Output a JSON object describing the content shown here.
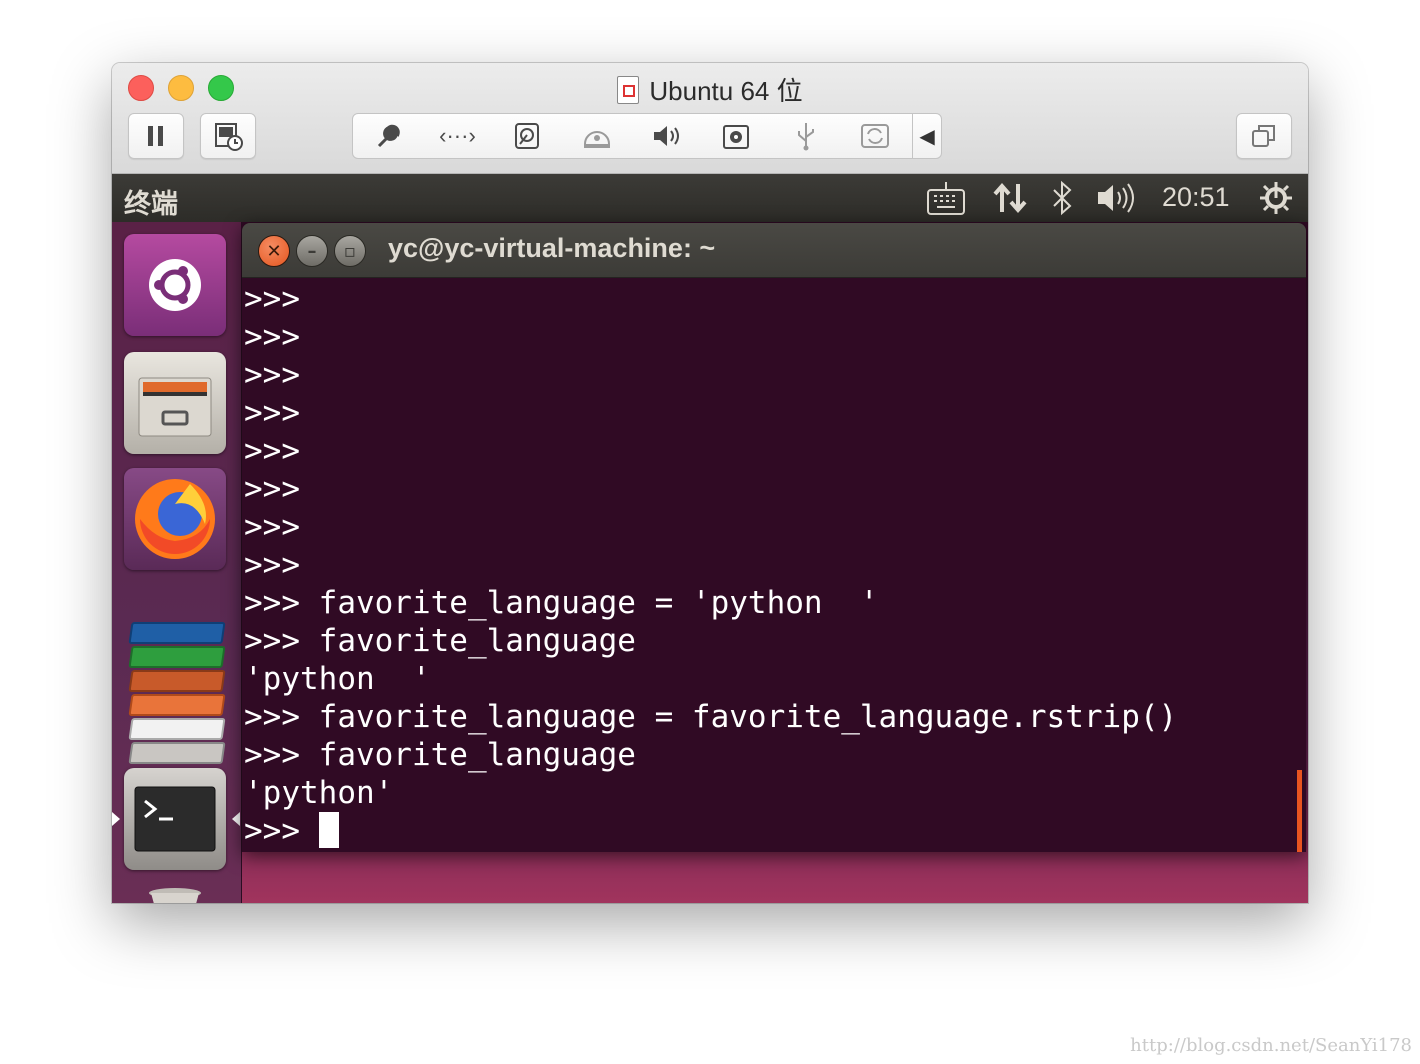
{
  "mac_window": {
    "title": "Ubuntu 64 位",
    "toolbar": {
      "pause_icon": "pause-icon",
      "snapshot_icon": "snapshot-icon",
      "group_icons": [
        "wrench-icon",
        "network-icon",
        "hard-disk-icon",
        "optical-drive-icon",
        "speaker-icon",
        "camera-icon",
        "usb-icon",
        "sync-icon"
      ],
      "collapse_icon": "chevron-left-icon",
      "fullscreen_icon": "restore-window-icon"
    }
  },
  "ubuntu_panel": {
    "app_title": "终端",
    "indicators": [
      "keyboard-icon",
      "network-updown-icon",
      "bluetooth-icon",
      "volume-icon",
      "power-gear-icon"
    ],
    "clock": "20:51"
  },
  "launcher": {
    "items": [
      "ubuntu-dash",
      "files",
      "firefox",
      "libreoffice-writer",
      "libreoffice-calc",
      "libreoffice-impress",
      "ubuntu-software",
      "amazon",
      "system-settings",
      "terminal",
      "trash"
    ]
  },
  "terminal": {
    "title": "yc@yc-virtual-machine: ~",
    "lines": [
      ">>>",
      ">>>",
      ">>>",
      ">>>",
      ">>>",
      ">>>",
      ">>>",
      ">>>",
      ">>> favorite_language = 'python  '",
      ">>> favorite_language",
      "'python  '",
      ">>> favorite_language = favorite_language.rstrip()",
      ">>> favorite_language",
      "'python'",
      ">>> "
    ]
  },
  "watermark": "http://blog.csdn.net/SeanYi178",
  "colors": {
    "terminal_bg": "#300a24",
    "panel_bg": "#3c3b37",
    "ubuntu_orange": "#e95420"
  }
}
